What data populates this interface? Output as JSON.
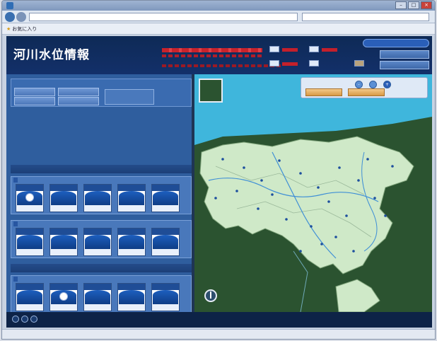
{
  "browser": {
    "title": "",
    "url": "",
    "favorites_label": "お気に入り",
    "toolbar_text": ""
  },
  "header": {
    "site_title": "河川水位情報",
    "org_line1": "",
    "org_line2": "",
    "note": "",
    "legend_title": "",
    "to_top_button": "",
    "button1": "",
    "button2": ""
  },
  "notice": {
    "title": "",
    "buttons": [
      "",
      "",
      "",
      ""
    ],
    "info": ""
  },
  "section1": {
    "label": "",
    "link": ""
  },
  "section2": {
    "label": "",
    "link": ""
  },
  "groups": {
    "a": {
      "tag": "",
      "gauges": [
        {
          "name": "",
          "value": "",
          "status": "normal-dot"
        },
        {
          "name": "",
          "value": "",
          "status": "water"
        },
        {
          "name": "",
          "value": "",
          "status": "water"
        },
        {
          "name": "",
          "value": "",
          "status": "water"
        },
        {
          "name": "",
          "value": "",
          "status": "water"
        }
      ]
    },
    "b": {
      "tag": "",
      "gauges": [
        {
          "name": "",
          "value": "",
          "status": "water"
        },
        {
          "name": "",
          "value": "",
          "status": "water"
        },
        {
          "name": "",
          "value": "",
          "status": "water"
        },
        {
          "name": "",
          "value": "",
          "status": "water"
        },
        {
          "name": "",
          "value": "",
          "status": "water"
        }
      ]
    },
    "c": {
      "tag": "",
      "gauges": [
        {
          "name": "",
          "value": "",
          "status": "water"
        },
        {
          "name": "",
          "value": "",
          "status": "normal-dot"
        },
        {
          "name": "",
          "value": "",
          "status": "water"
        },
        {
          "name": "",
          "value": "",
          "status": "water"
        },
        {
          "name": "",
          "value": "",
          "status": "water"
        }
      ]
    },
    "d": {
      "tag": "",
      "gauges": [
        {
          "name": "",
          "value": "",
          "status": "water"
        },
        {
          "name": "",
          "value": "",
          "status": "water"
        }
      ]
    }
  },
  "map": {
    "ctrl_label": "",
    "button1": "",
    "button2": "",
    "layer_label": "",
    "zoom_out": "-",
    "zoom_in": "+"
  },
  "footer": {
    "note1": "",
    "note2": ""
  },
  "status": {
    "left": "",
    "mid": "",
    "zoom": ""
  },
  "colors": {
    "header_bg": "#0e2a56",
    "panel_bg": "#2f5e9e",
    "map_sea": "#3fb6dc",
    "land": "#cfe9c8",
    "hill": "#2b5330",
    "button_orange": "#d89a45"
  }
}
